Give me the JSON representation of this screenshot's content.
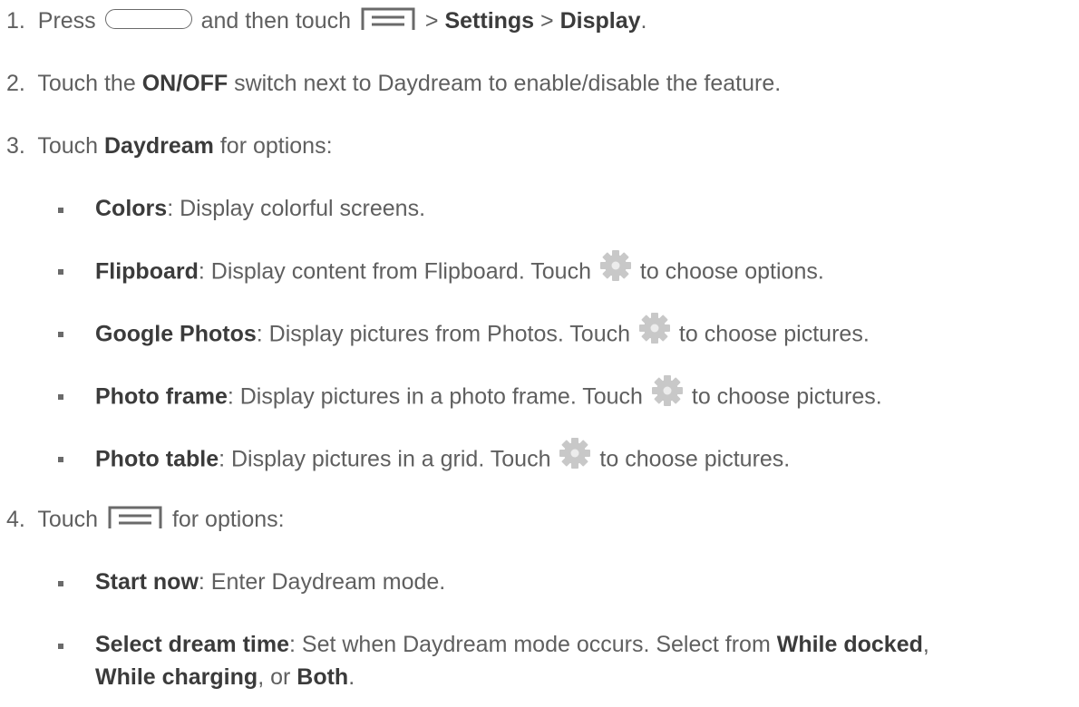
{
  "steps": {
    "s1": {
      "num": "1.",
      "pre": "Press",
      "mid": "and then touch",
      "gt1": ">",
      "settings": "Settings",
      "gt2": ">",
      "display": "Display",
      "end": "."
    },
    "s2": {
      "num": "2.",
      "pre": "Touch the",
      "onoff": "ON/OFF",
      "post": "switch next to Daydream to enable/disable the feature."
    },
    "s3": {
      "num": "3.",
      "pre": "Touch",
      "daydream": "Daydream",
      "post": "for options:"
    },
    "s4": {
      "num": "4.",
      "pre": "Touch",
      "post": "for options:"
    }
  },
  "daydream_options": [
    {
      "name": "Colors",
      "desc": ": Display colorful screens."
    },
    {
      "name": "Flipboard",
      "desc": ": Display content from Flipboard. Touch",
      "after": "to choose options."
    },
    {
      "name": "Google Photos",
      "desc": ": Display pictures from Photos. Touch",
      "after": "to choose pictures."
    },
    {
      "name": "Photo frame",
      "desc": ": Display pictures in a photo frame. Touch",
      "after": "to choose pictures."
    },
    {
      "name": "Photo table",
      "desc": ": Display pictures in a grid. Touch",
      "after": "to choose pictures."
    }
  ],
  "menu_options": [
    {
      "name": "Start now",
      "desc": ": Enter Daydream mode."
    },
    {
      "name": "Select dream time",
      "desc": ": Set when Daydream mode occurs. Select from",
      "opt1": "While docked",
      "comma1": ",",
      "opt2": "While charging",
      "or": ", or",
      "opt3": "Both",
      "end": "."
    }
  ],
  "icons": {
    "home": "home-button-icon",
    "menu": "menu-button-icon",
    "gear": "gear-icon"
  },
  "colors": {
    "text": "#5f5f5f",
    "bold": "#3b3b3b",
    "gear": "#c8c8c8"
  }
}
